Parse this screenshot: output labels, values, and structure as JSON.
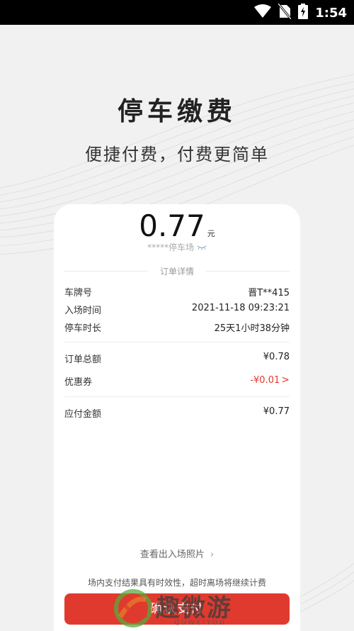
{
  "status_bar": {
    "time": "1:54"
  },
  "hero": {
    "title": "停车缴费",
    "subtitle": "便捷付费，付费更简单"
  },
  "order": {
    "amount": "0.77",
    "currency": "元",
    "parking_lot": "*****停车场",
    "section_title": "订单详情",
    "plate_label": "车牌号",
    "plate_value": "晋T**415",
    "entry_label": "入场时间",
    "entry_value": "2021-11-18 09:23:21",
    "duration_label": "停车时长",
    "duration_value": "25天1小时38分钟",
    "total_label": "订单总额",
    "total_value": "¥0.78",
    "coupon_label": "优惠券",
    "coupon_value": "-¥0.01",
    "payable_label": "应付金额",
    "payable_value": "¥0.77"
  },
  "photo_link": "查看出入场照片",
  "notice": "场内支付结果具有时效性，超时离场将继续计费",
  "pay_button": "确认支付",
  "watermark": {
    "text": "趣微游",
    "sub": "QUWEIYOU"
  },
  "colors": {
    "accent": "#e03a2e",
    "background": "#f1f1f1",
    "card": "#ffffff"
  },
  "icons": [
    "wifi-icon",
    "no-sim-icon",
    "battery-charging-icon",
    "eye-closed-icon",
    "chevron-right-icon"
  ]
}
